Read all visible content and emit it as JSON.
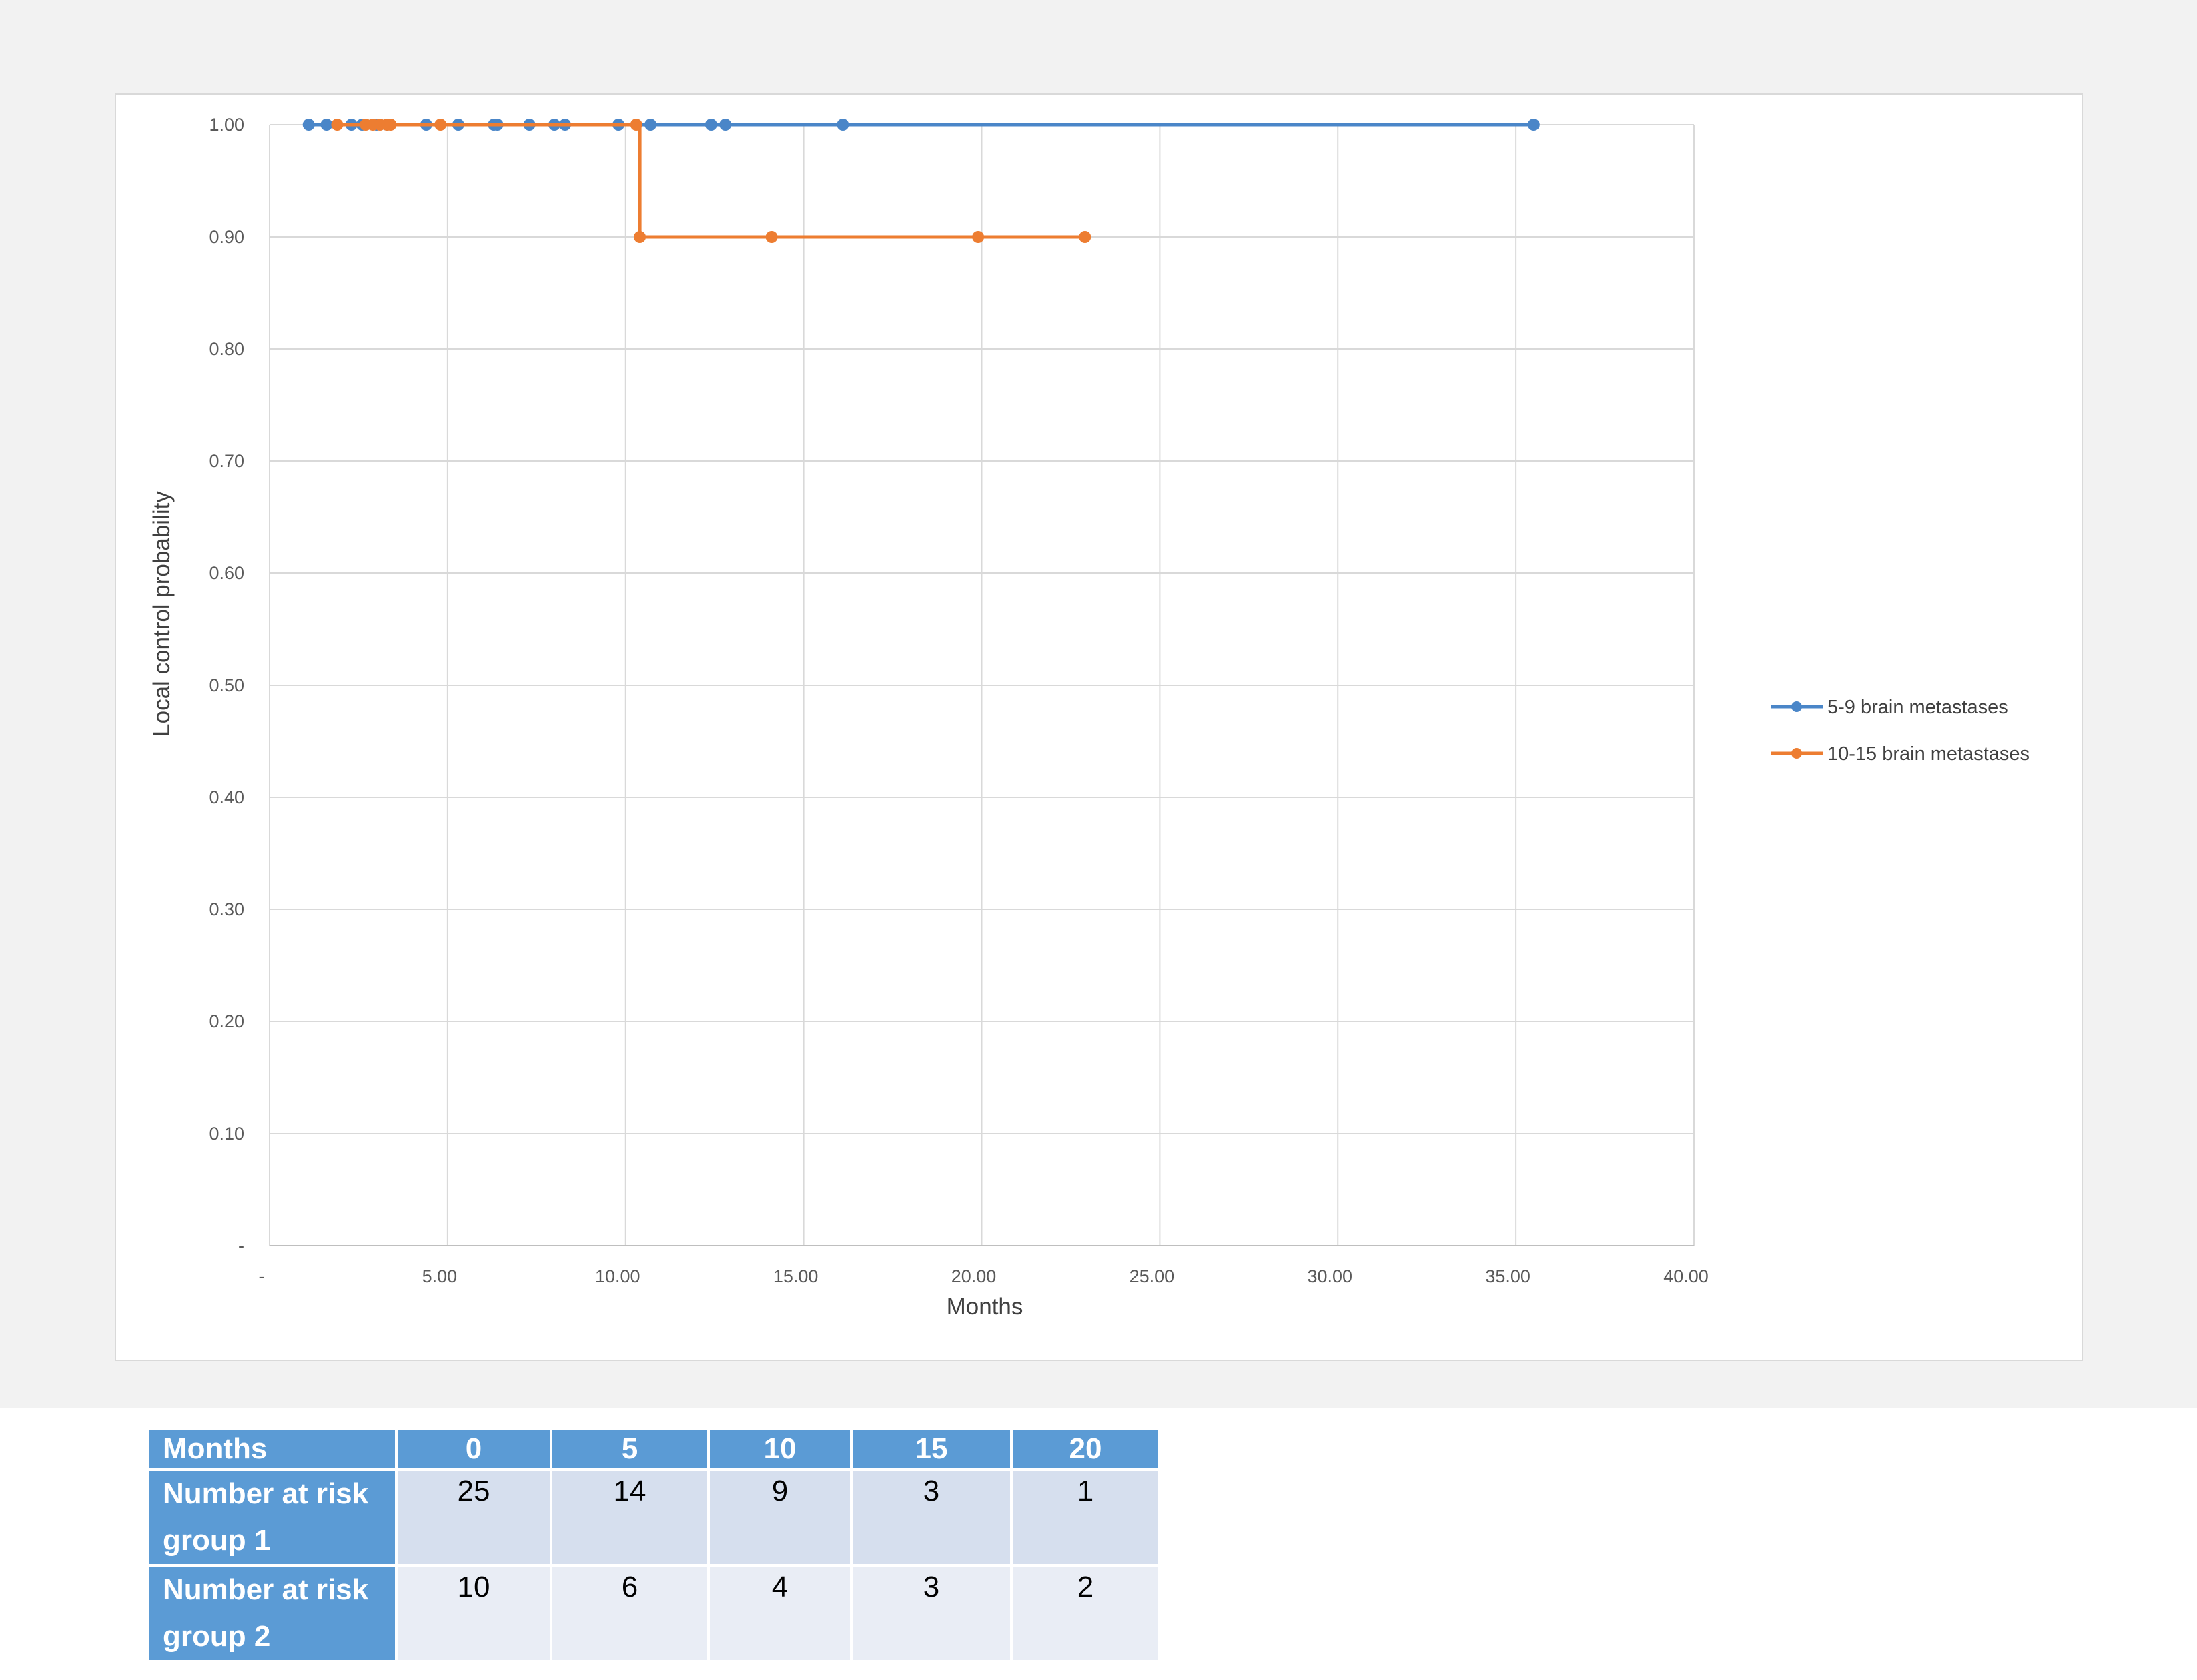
{
  "chart_data": {
    "type": "line",
    "title": "",
    "xlabel": "Months",
    "ylabel": "Local control probability",
    "xlim": [
      0,
      40
    ],
    "ylim": [
      0,
      1
    ],
    "x_ticks": [
      "-",
      "5.00",
      "10.00",
      "15.00",
      "20.00",
      "25.00",
      "30.00",
      "35.00",
      "40.00"
    ],
    "y_ticks": [
      "-",
      "0.10",
      "0.20",
      "0.30",
      "0.40",
      "0.50",
      "0.60",
      "0.70",
      "0.80",
      "0.90",
      "1.00"
    ],
    "grid": true,
    "legend_position": "right",
    "series": [
      {
        "name": "5-9 brain metastases",
        "color": "#4a86c8",
        "x": [
          1.1,
          1.6,
          2.3,
          2.6,
          3.0,
          3.3,
          4.4,
          5.3,
          6.3,
          6.4,
          7.3,
          8.0,
          8.3,
          9.8,
          10.7,
          12.4,
          12.8,
          16.1,
          35.5
        ],
        "y": [
          1,
          1,
          1,
          1,
          1,
          1,
          1,
          1,
          1,
          1,
          1,
          1,
          1,
          1,
          1,
          1,
          1,
          1,
          1
        ]
      },
      {
        "name": "10-15 brain metastases",
        "color": "#ed7d31",
        "x": [
          1.9,
          2.7,
          2.9,
          3.1,
          3.3,
          3.4,
          4.8,
          10.3,
          10.4,
          14.1,
          19.9,
          22.9
        ],
        "y": [
          1,
          1,
          1,
          1,
          1,
          1,
          1,
          1,
          0.9,
          0.9,
          0.9,
          0.9
        ]
      }
    ]
  },
  "risk_table": {
    "header": [
      "Months",
      "0",
      "5",
      "10",
      "15",
      "20"
    ],
    "rows": [
      {
        "label_line1": "Number at risk",
        "label_line2": "group 1",
        "values": [
          "25",
          "14",
          "9",
          "3",
          "1"
        ]
      },
      {
        "label_line1": "Number at risk",
        "label_line2": "group 2",
        "values": [
          "10",
          "6",
          "4",
          "3",
          "2"
        ]
      }
    ]
  }
}
